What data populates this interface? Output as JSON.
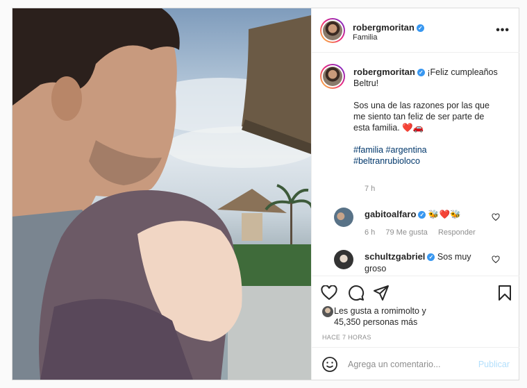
{
  "post": {
    "username": "robergmoritan",
    "location": "Familia",
    "more_icon": "more-horizontal-icon",
    "caption": {
      "line1": "¡Feliz cumpleaños",
      "line2": "Beltru!",
      "line3": "Sos una de las razones por las que",
      "line4": "me siento tan feliz de ser parte de",
      "line5": "esta familia. ❤️🚗",
      "hashtags1": "#familia #argentina",
      "hashtags2": "#beltranrubioloco"
    },
    "caption_time": "7 h",
    "comments": [
      {
        "username": "gabitoalfaro",
        "text": "🐝❤️🐝",
        "time": "6 h",
        "likes": "79 Me gusta",
        "reply": "Responder"
      },
      {
        "username": "schultzgabriel",
        "text_line1": "Sos muy",
        "text_line2": "groso"
      }
    ],
    "likes_line1": "Les gusta a romimolto y",
    "likes_line2": "45,350 personas más",
    "time_ago": "HACE 7 HORAS",
    "comment_placeholder": "Agrega un comentario...",
    "publish_label": "Publicar",
    "colors": {
      "link": "#00376b",
      "verified": "#3897f0",
      "publish_disabled": "#b2dffc",
      "heart_red": "#ed4956"
    }
  }
}
